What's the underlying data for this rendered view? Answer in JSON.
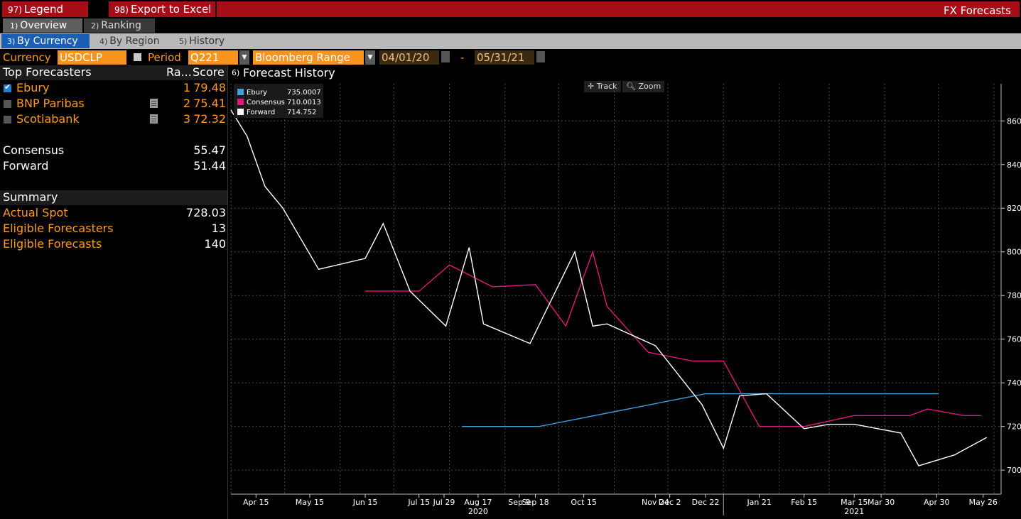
{
  "toolbar": {
    "legend": {
      "num": "97)",
      "label": "Legend"
    },
    "export": {
      "num": "98)",
      "label": "Export to Excel"
    },
    "app_title": "FX Forecasts"
  },
  "tabs": [
    {
      "num": "1)",
      "label": "Overview"
    },
    {
      "num": "2)",
      "label": "Ranking"
    }
  ],
  "subtabs": [
    {
      "num": "3)",
      "label": "By Currency"
    },
    {
      "num": "4)",
      "label": "By Region"
    },
    {
      "num": "5)",
      "label": "History"
    }
  ],
  "controls": {
    "currency_label": "Currency",
    "currency_value": "USDCLP",
    "period_label": "Period",
    "period_value": "Q221",
    "range_value": "Bloomberg Range",
    "start_date": "04/01/20",
    "dash": "-",
    "end_date": "05/31/21"
  },
  "left": {
    "header": {
      "title": "Top Forecasters",
      "rank": "Ra...",
      "score": "Score"
    },
    "forecasters": [
      {
        "name": "Ebury",
        "rank": "1",
        "score": "79.48",
        "checked": true
      },
      {
        "name": "BNP Paribas",
        "rank": "2",
        "score": "75.41",
        "checked": false
      },
      {
        "name": "Scotiabank",
        "rank": "3",
        "score": "72.32",
        "checked": false
      }
    ],
    "consensus": {
      "label": "Consensus",
      "value": "55.47"
    },
    "forward": {
      "label": "Forward",
      "value": "51.44"
    },
    "summary": {
      "title": "Summary",
      "rows": [
        {
          "label": "Actual Spot",
          "value": "728.03"
        },
        {
          "label": "Eligible Forecasters",
          "value": "13"
        },
        {
          "label": "Eligible Forecasts",
          "value": "140"
        }
      ]
    }
  },
  "chart_header": {
    "num": "6)",
    "title": "Forecast History",
    "track": "Track",
    "zoom": "Zoom"
  },
  "chart_data": {
    "type": "line",
    "x_tick_labels": [
      "Apr 15",
      "May 15",
      "Jun 15",
      "Jul 15",
      "Jul 29",
      "Aug 17",
      "Sep 9",
      "Sep 18",
      "Oct 15",
      "Nov 24",
      "Dec 2",
      "Dec 22",
      "Jan 21",
      "Feb 15",
      "Mar 15",
      "Mar 30",
      "Apr 30",
      "May 26"
    ],
    "year_labels": [
      "2020",
      "2021"
    ],
    "y_ticks": [
      700,
      720,
      740,
      760,
      780,
      800,
      820,
      840,
      860
    ],
    "ylim": [
      689,
      877
    ],
    "xlim": [
      "2020-04-01",
      "2021-06-05"
    ],
    "legend": [
      {
        "name": "Ebury",
        "value": "735.0007",
        "color": "#3fa0e0"
      },
      {
        "name": "Consensus",
        "value": "710.0013",
        "color": "#e0187c"
      },
      {
        "name": "Forward",
        "value": "714.752",
        "color": "#ffffff"
      }
    ],
    "series": [
      {
        "name": "Ebury",
        "color": "#3fa0e0",
        "x": [
          "2020-08-08",
          "2020-09-20",
          "2020-12-22",
          "2021-05-01"
        ],
        "y": [
          720,
          720,
          735,
          735
        ]
      },
      {
        "name": "Consensus",
        "color": "#e0187c",
        "x": [
          "2020-06-15",
          "2020-07-15",
          "2020-08-01",
          "2020-08-25",
          "2020-09-18",
          "2020-10-05",
          "2020-10-20",
          "2020-10-28",
          "2020-11-20",
          "2020-12-15",
          "2021-01-01",
          "2021-01-21",
          "2021-02-15",
          "2021-03-15",
          "2021-04-15",
          "2021-04-25",
          "2021-05-15",
          "2021-05-25"
        ],
        "y": [
          782,
          782,
          794,
          784,
          785,
          766,
          800,
          775,
          754,
          750,
          750,
          720,
          720,
          725,
          725,
          728,
          725,
          725
        ]
      },
      {
        "name": "Forward",
        "color": "#ffffff",
        "x": [
          "2020-04-01",
          "2020-04-10",
          "2020-04-20",
          "2020-04-30",
          "2020-05-20",
          "2020-06-15",
          "2020-06-25",
          "2020-07-10",
          "2020-07-30",
          "2020-08-12",
          "2020-08-20",
          "2020-09-15",
          "2020-10-10",
          "2020-10-20",
          "2020-10-28",
          "2020-11-24",
          "2020-12-20",
          "2021-01-01",
          "2021-01-10",
          "2021-01-25",
          "2021-02-15",
          "2021-03-01",
          "2021-03-15",
          "2021-04-10",
          "2021-04-20",
          "2021-05-10",
          "2021-05-28"
        ],
        "y": [
          865,
          853,
          830,
          820,
          792,
          797,
          813,
          782,
          766,
          802,
          767,
          758,
          800,
          766,
          767,
          757,
          730,
          710,
          734,
          735,
          719,
          721,
          721,
          717,
          702,
          707,
          715
        ]
      }
    ]
  }
}
